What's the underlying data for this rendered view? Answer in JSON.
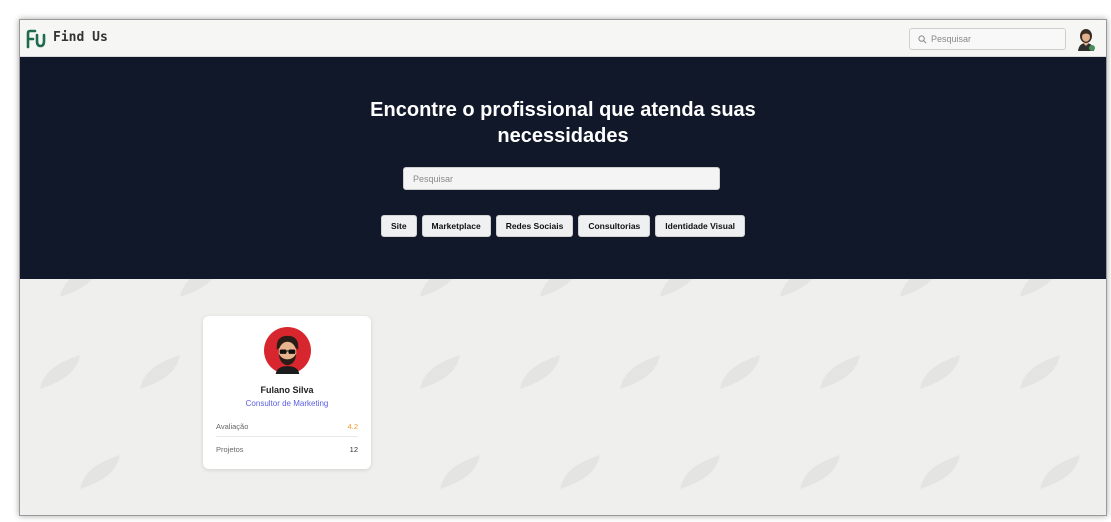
{
  "app": {
    "brand": "Find Us"
  },
  "navbar": {
    "search_placeholder": "Pesquisar"
  },
  "hero": {
    "title_line1": "Encontre o profissional que atenda suas",
    "title_line2": "necessidades",
    "search_placeholder": "Pesquisar",
    "categories": [
      "Site",
      "Marketplace",
      "Redes Sociais",
      "Consultorias",
      "Identidade Visual"
    ]
  },
  "profile_card": {
    "name": "Fulano Silva",
    "role": "Consultor de Marketing",
    "rating_label": "Avaliação",
    "rating_value": "4.2",
    "projects_label": "Projetos",
    "projects_value": "12"
  },
  "colors": {
    "hero_bg": "#111829",
    "accent_role": "#5b5fe0",
    "rating": "#f39a2a",
    "logo": "#1f6b4e",
    "avatar_bg": "#d8262e"
  },
  "icons": {
    "logo": "fu-logo-icon",
    "search": "search-icon",
    "user_avatar": "user-avatar-icon",
    "profile_avatar": "profile-avatar-icon"
  }
}
